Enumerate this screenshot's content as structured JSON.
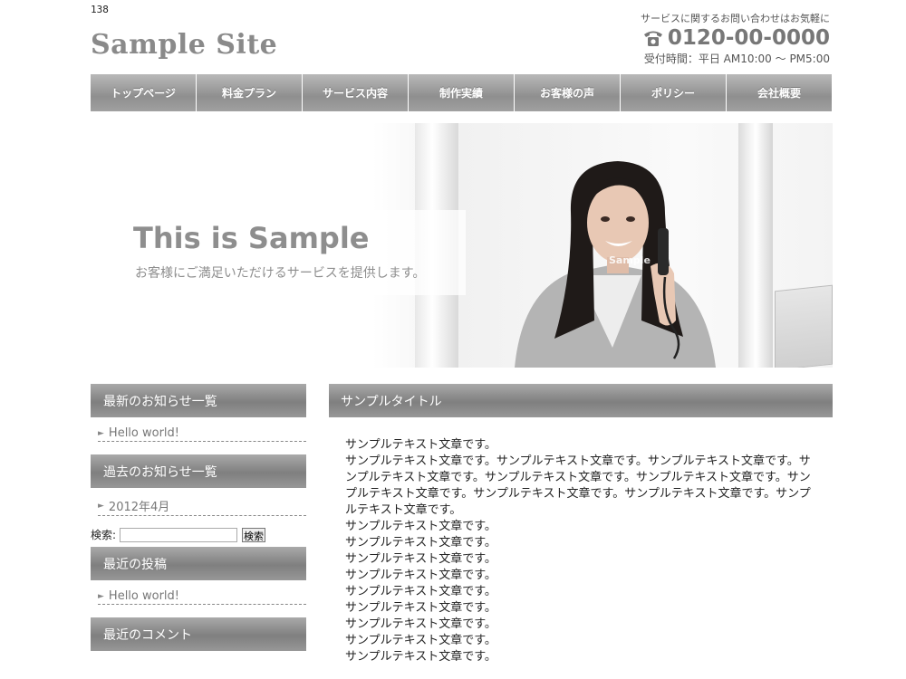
{
  "page_number": "138",
  "header": {
    "logo": "Sample Site",
    "contact_note": "サービスに関するお問い合わせはお気軽に",
    "phone": "0120-00-0000",
    "hours": "受付時間：平日 AM10:00 ～ PM5:00"
  },
  "nav": {
    "items": [
      {
        "label": "トップページ"
      },
      {
        "label": "料金プラン"
      },
      {
        "label": "サービス内容"
      },
      {
        "label": "制作実績"
      },
      {
        "label": "お客様の声"
      },
      {
        "label": "ポリシー"
      },
      {
        "label": "会社概要"
      }
    ]
  },
  "hero": {
    "title": "This is Sample",
    "subtitle": "お客様にご満足いただけるサービスを提供します。",
    "watermark": "Sample"
  },
  "sidebar": {
    "latest_heading": "最新のお知らせ一覧",
    "latest_item": "Hello world!",
    "archive_heading": "過去のお知らせ一覧",
    "archive_item": "2012年4月",
    "search_label": "検索:",
    "search_value": "",
    "search_button": "検索",
    "recent_posts_heading": "最近の投稿",
    "recent_post_item": "Hello world!",
    "recent_comments_heading": "最近のコメント"
  },
  "main": {
    "heading": "サンプルタイトル",
    "paragraphs": [
      "サンプルテキスト文章です。",
      "サンプルテキスト文章です。サンプルテキスト文章です。サンプルテキスト文章です。サンプルテキスト文章です。サンプルテキスト文章です。サンプルテキスト文章です。サンプルテキスト文章です。サンプルテキスト文章です。サンプルテキスト文章です。サンプルテキスト文章です。",
      "サンプルテキスト文章です。",
      "サンプルテキスト文章です。",
      "サンプルテキスト文章です。",
      "サンプルテキスト文章です。",
      "サンプルテキスト文章です。",
      "サンプルテキスト文章です。",
      "サンプルテキスト文章です。",
      "サンプルテキスト文章です。",
      "サンプルテキスト文章です。"
    ]
  }
}
